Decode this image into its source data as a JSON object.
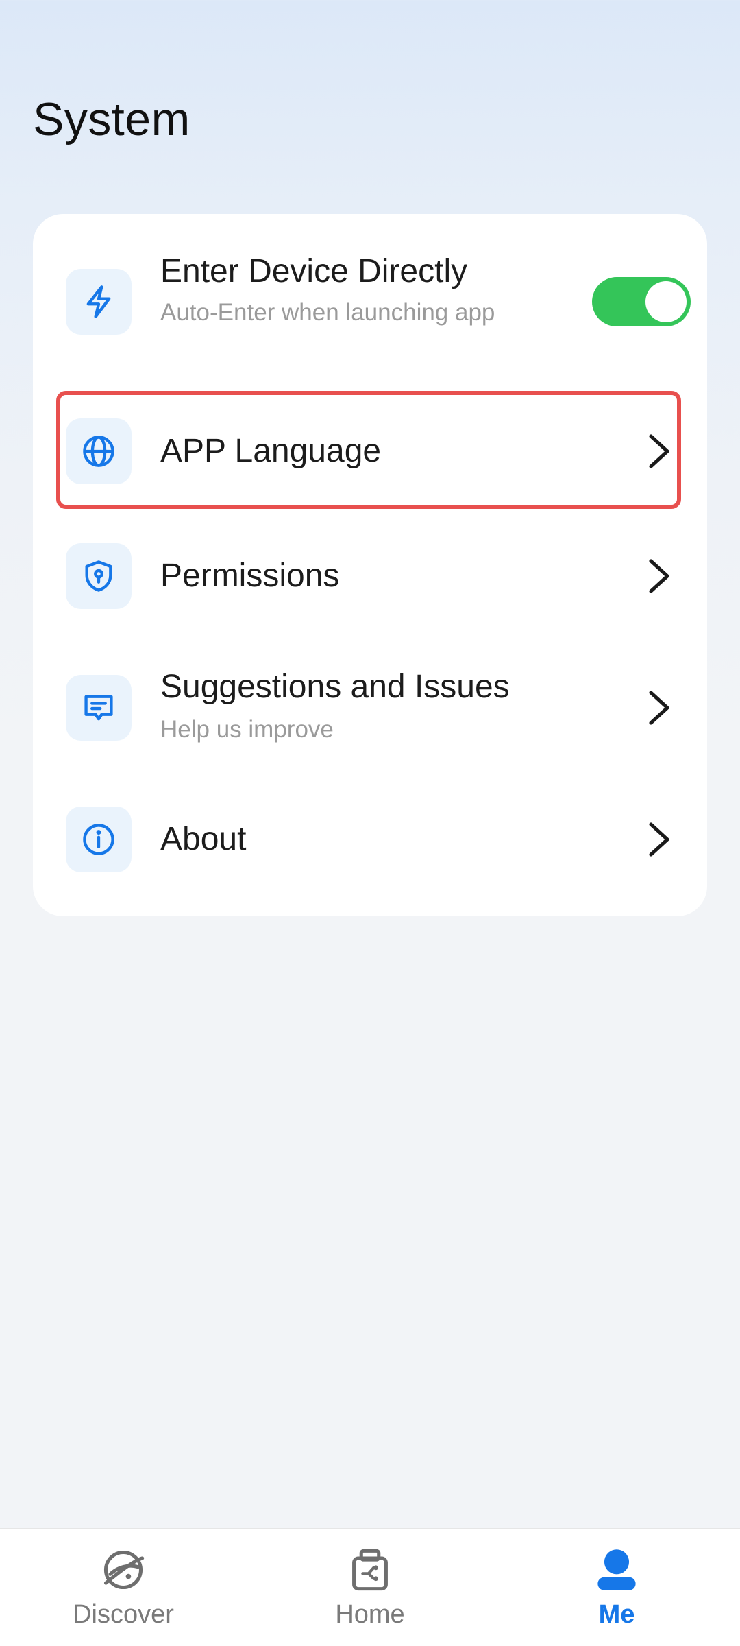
{
  "page": {
    "title": "System"
  },
  "settings": {
    "enter_device": {
      "title": "Enter Device Directly",
      "subtitle": "Auto-Enter when launching app",
      "toggle_on": true,
      "icon": "lightning-icon"
    },
    "app_language": {
      "title": "APP Language",
      "icon": "globe-icon"
    },
    "permissions": {
      "title": "Permissions",
      "icon": "shield-lock-icon"
    },
    "suggestions": {
      "title": "Suggestions and Issues",
      "subtitle": "Help us improve",
      "icon": "message-icon"
    },
    "about": {
      "title": "About",
      "icon": "info-icon"
    }
  },
  "tabbar": {
    "discover": {
      "label": "Discover",
      "icon": "planet-icon"
    },
    "home": {
      "label": "Home",
      "icon": "device-icon"
    },
    "me": {
      "label": "Me",
      "icon": "person-icon",
      "active": true
    }
  },
  "colors": {
    "accent": "#1677e8",
    "toggle_on": "#34c559",
    "highlight": "#e8504e"
  }
}
